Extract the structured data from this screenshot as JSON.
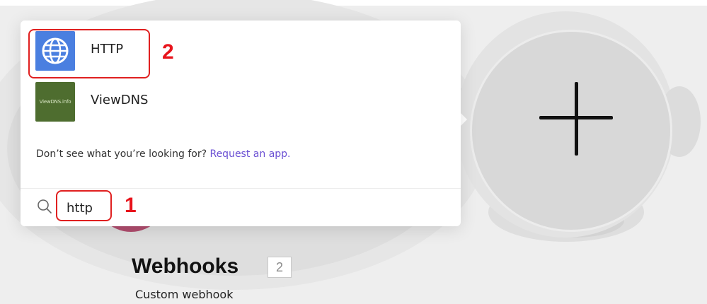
{
  "popup": {
    "apps": [
      {
        "label": "HTTP",
        "icon": "globe-icon"
      },
      {
        "label": "ViewDNS",
        "icon": "viewdns-logo-icon",
        "logo_text": "ViewDNS.info"
      }
    ],
    "hint_text": "Don’t see what you’re looking for?",
    "hint_link": "Request an app.",
    "search": {
      "value": "http",
      "icon": "search-icon"
    }
  },
  "module": {
    "title": "Webhooks",
    "count": "2",
    "subtitle": "Custom webhook"
  },
  "add_button": {
    "icon": "plus-icon"
  },
  "annotations": [
    {
      "number": "1",
      "target": "search-input"
    },
    {
      "number": "2",
      "target": "app-http"
    }
  ],
  "colors": {
    "annotation": "#e02020",
    "link": "#6a4fd3",
    "http_icon_bg": "#4a7fe0",
    "viewdns_icon_bg": "#4e6d2f",
    "webhook_module": "#b04d6e"
  }
}
